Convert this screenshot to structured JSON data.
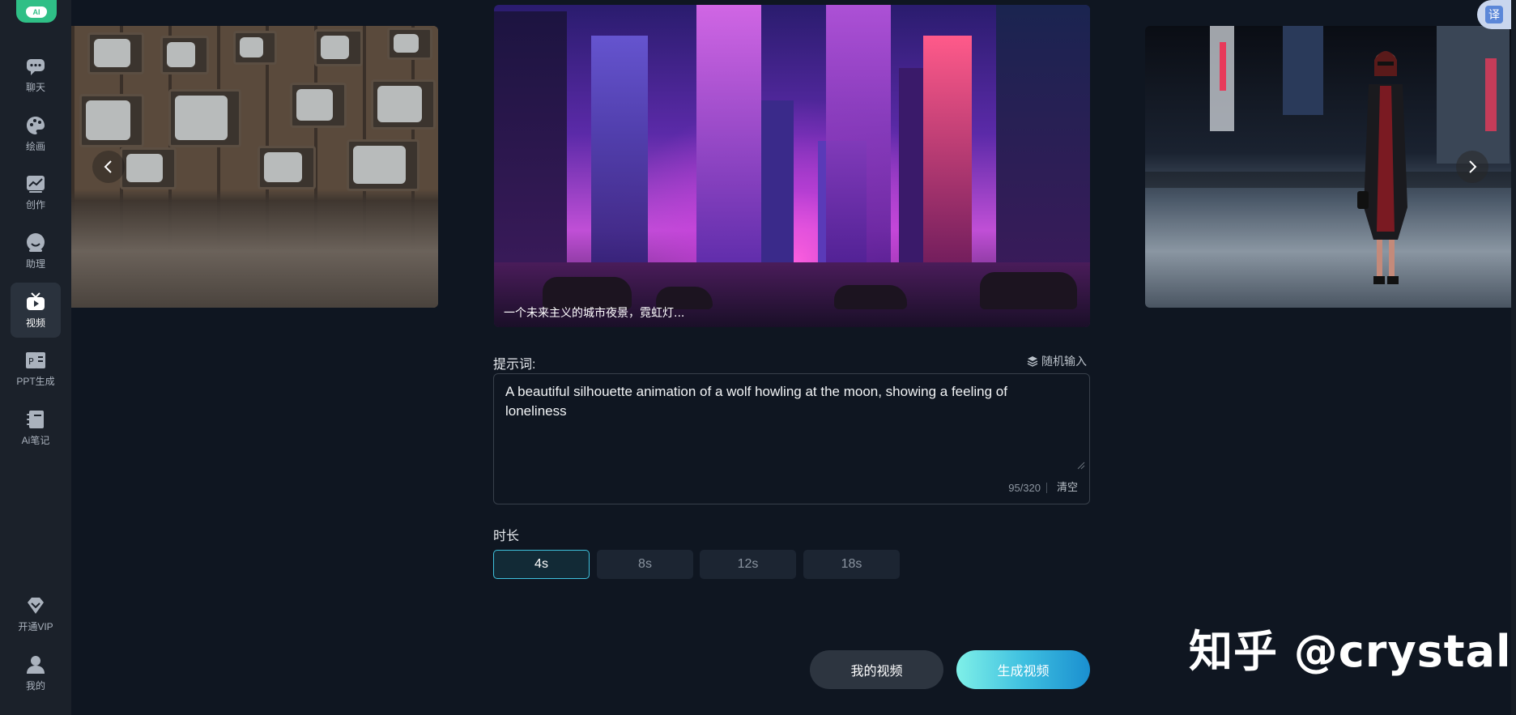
{
  "sidebar": {
    "logo_text": "AI",
    "items": [
      {
        "label": "聊天",
        "icon": "chat-icon"
      },
      {
        "label": "绘画",
        "icon": "palette-icon"
      },
      {
        "label": "创作",
        "icon": "chart-icon"
      },
      {
        "label": "助理",
        "icon": "assistant-icon"
      },
      {
        "label": "视频",
        "icon": "tv-icon",
        "active": true
      },
      {
        "label": "PPT生成",
        "icon": "ppt-icon"
      },
      {
        "label": "Ai笔记",
        "icon": "notebook-icon"
      }
    ],
    "bottom": [
      {
        "label": "开通VIP",
        "icon": "diamond-icon"
      },
      {
        "label": "我的",
        "icon": "user-icon"
      }
    ]
  },
  "carousel": {
    "center_caption": "一个未来主义的城市夜景，霓虹灯..."
  },
  "translate_label": "译",
  "prompt": {
    "label": "提示词:",
    "random_label": "随机输入",
    "value": "A beautiful silhouette animation of a wolf howling at the moon, showing a feeling of loneliness",
    "count": "95/320",
    "clear_label": "清空"
  },
  "duration": {
    "label": "时长",
    "options": [
      "4s",
      "8s",
      "12s",
      "18s"
    ],
    "selected": "4s"
  },
  "actions": {
    "my_videos": "我的视频",
    "generate": "生成视频"
  },
  "watermark": "知乎 @crystal",
  "colors": {
    "accent": "#3fc2de",
    "sidebar_bg": "#1b212a",
    "page_bg": "#0f1621",
    "logo": "#2fbf86"
  }
}
